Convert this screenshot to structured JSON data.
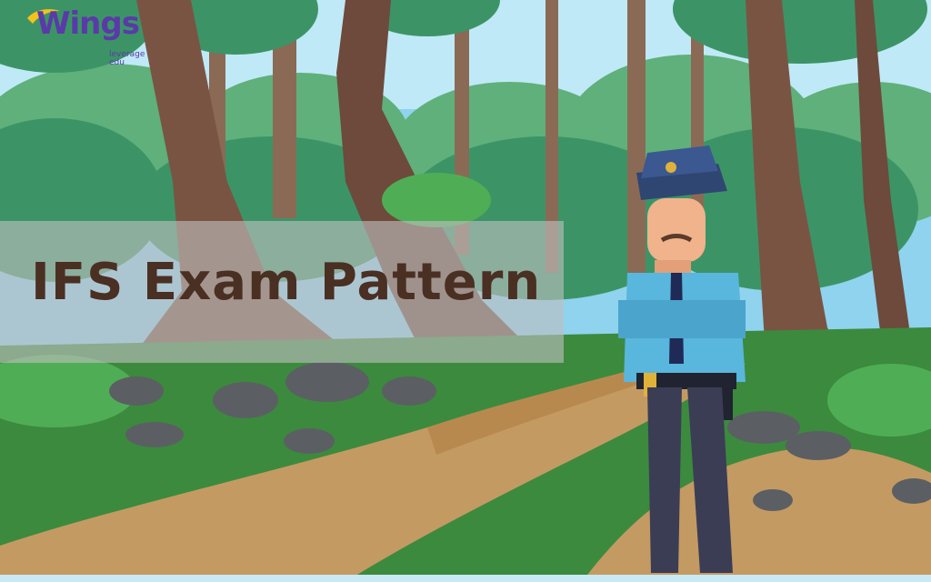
{
  "brand": {
    "name": "Wings",
    "tagline_line1": "leverage",
    "tagline_line2": "edu"
  },
  "headline": "IFS Exam Pattern",
  "colors": {
    "brand_purple": "#5a3aa8",
    "brand_yellow": "#f3c21b",
    "headline_brown": "#4a2f23",
    "band_gray": "#bebebe"
  }
}
